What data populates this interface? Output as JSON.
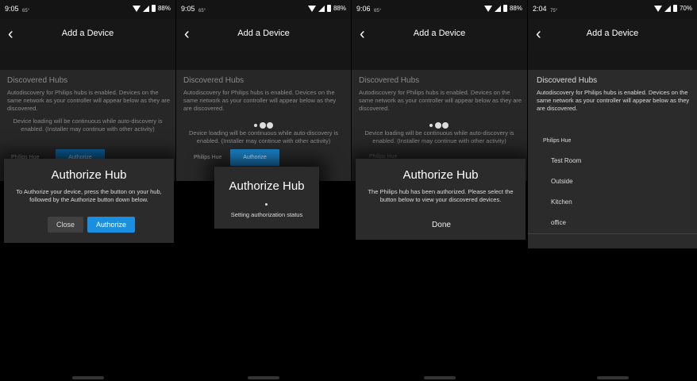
{
  "screens": [
    {
      "status": {
        "time": "9:05",
        "temp": "65°",
        "battery": "88%"
      },
      "header": {
        "back": "‹",
        "title": "Add a Device"
      },
      "section_title": "Discovered Hubs",
      "description": "Autodiscovery for Philips hubs is enabled. Devices on the same network as your controller will appear below as they are discovered.",
      "loading_note": "Device loading will be continuous while auto-discovery is enabled. (Installer may continue with other activity)",
      "hub_name": "Philips Hue",
      "hub_button": "Authorize",
      "dialog": {
        "title": "Authorize Hub",
        "body": "To Authorize your device, press the button on your hub, followed by the Authorize button down below.",
        "close": "Close",
        "authorize": "Authorize"
      }
    },
    {
      "status": {
        "time": "9:05",
        "temp": "65°",
        "battery": "88%"
      },
      "header": {
        "back": "‹",
        "title": "Add a Device"
      },
      "section_title": "Discovered Hubs",
      "description": "Autodiscovery for Philips hubs is enabled. Devices on the same network as your controller will appear below as they are discovered.",
      "loading_note": "Device loading will be continuous while auto-discovery is enabled. (Installer may continue with other activity)",
      "hub_name": "Philips Hue",
      "hub_button": "Authorize",
      "dialog": {
        "title": "Authorize Hub",
        "status": "Setting authorization status"
      }
    },
    {
      "status": {
        "time": "9:06",
        "temp": "65°",
        "battery": "88%"
      },
      "header": {
        "back": "‹",
        "title": "Add a Device"
      },
      "section_title": "Discovered Hubs",
      "description": "Autodiscovery for Philips hubs is enabled. Devices on the same network as your controller will appear below as they are discovered.",
      "loading_note": "Device loading will be continuous while auto-discovery is enabled. (Installer may continue with other activity)",
      "hub_name": "Philips Hue",
      "dialog": {
        "title": "Authorize Hub",
        "body": "The Philips hub has been authorized. Please select the button below to view your discovered devices.",
        "done": "Done"
      }
    },
    {
      "status": {
        "time": "2:04",
        "temp": "75°",
        "battery": "70%"
      },
      "header": {
        "back": "‹",
        "title": "Add a Device"
      },
      "section_title": "Discovered Hubs",
      "description": "Autodiscovery for Philips hubs is enabled. Devices on the same network as your controller will appear below as they are discovered.",
      "list_header": "Philips Hue",
      "rooms": [
        "Test Room",
        "Outside",
        "Kitchen",
        "office"
      ]
    }
  ]
}
